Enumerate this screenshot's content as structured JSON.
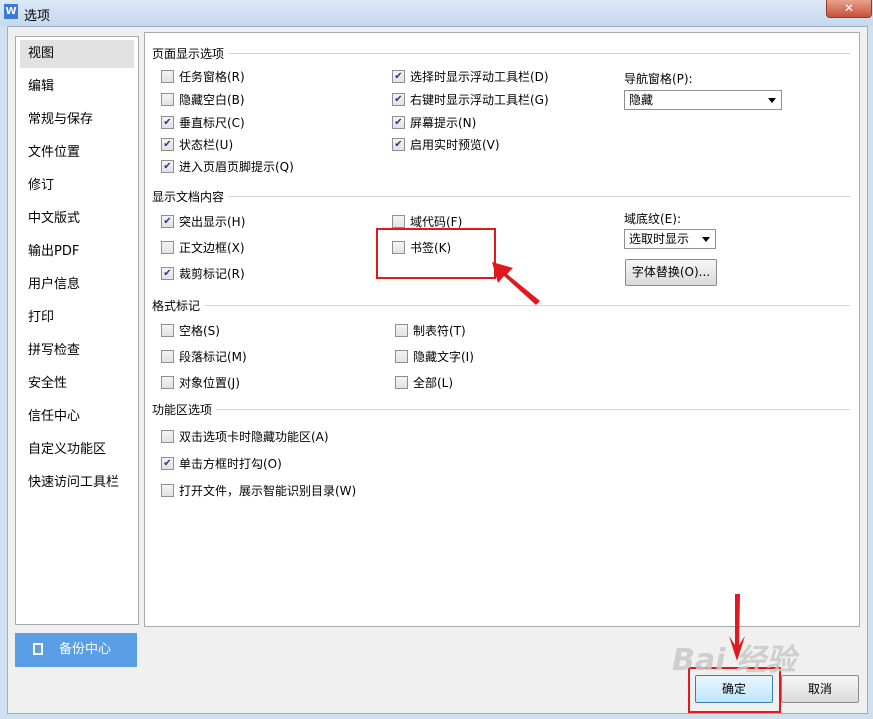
{
  "window": {
    "title": "选项",
    "app_icon_letter": "W",
    "close_glyph": "✕"
  },
  "sidebar": {
    "items": [
      {
        "label": "视图"
      },
      {
        "label": "编辑"
      },
      {
        "label": "常规与保存"
      },
      {
        "label": "文件位置"
      },
      {
        "label": "修订"
      },
      {
        "label": "中文版式"
      },
      {
        "label": "输出PDF"
      },
      {
        "label": "用户信息"
      },
      {
        "label": "打印"
      },
      {
        "label": "拼写检查"
      },
      {
        "label": "安全性"
      },
      {
        "label": "信任中心"
      },
      {
        "label": "自定义功能区"
      },
      {
        "label": "快速访问工具栏"
      }
    ],
    "active_index": 0,
    "backup_label": "备份中心"
  },
  "page_display": {
    "title": "页面显示选项",
    "col1": [
      {
        "label": "任务窗格(R)",
        "checked": false
      },
      {
        "label": "隐藏空白(B)",
        "checked": false
      },
      {
        "label": "垂直标尺(C)",
        "checked": true
      },
      {
        "label": "状态栏(U)",
        "checked": true
      },
      {
        "label": "进入页眉页脚提示(Q)",
        "checked": true
      }
    ],
    "col2": [
      {
        "label": "选择时显示浮动工具栏(D)",
        "checked": true
      },
      {
        "label": "右键时显示浮动工具栏(G)",
        "checked": true
      },
      {
        "label": "屏幕提示(N)",
        "checked": true
      },
      {
        "label": "启用实时预览(V)",
        "checked": true
      }
    ],
    "nav_label": "导航窗格(P):",
    "nav_value": "隐藏"
  },
  "doc_content": {
    "title": "显示文档内容",
    "col1": [
      {
        "label": "突出显示(H)",
        "checked": true
      },
      {
        "label": "正文边框(X)",
        "checked": false
      },
      {
        "label": "裁剪标记(R)",
        "checked": true
      }
    ],
    "col2": [
      {
        "label": "域代码(F)",
        "checked": false
      },
      {
        "label": "书签(K)",
        "checked": false
      }
    ],
    "field_label": "域底纹(E):",
    "field_value": "选取时显示",
    "font_replace_label": "字体替换(O)..."
  },
  "format_marks": {
    "title": "格式标记",
    "col1": [
      {
        "label": "空格(S)",
        "checked": false
      },
      {
        "label": "段落标记(M)",
        "checked": false
      },
      {
        "label": "对象位置(J)",
        "checked": false
      }
    ],
    "col2": [
      {
        "label": "制表符(T)",
        "checked": false
      },
      {
        "label": "隐藏文字(I)",
        "checked": false
      },
      {
        "label": "全部(L)",
        "checked": false
      }
    ]
  },
  "ribbon": {
    "title": "功能区选项",
    "items": [
      {
        "label": "双击选项卡时隐藏功能区(A)",
        "checked": false
      },
      {
        "label": "单击方框时打勾(O)",
        "checked": true
      },
      {
        "label": "打开文件，展示智能识别目录(W)",
        "checked": false
      }
    ]
  },
  "footer": {
    "ok_label": "确定",
    "cancel_label": "取消"
  },
  "watermark_text": "Bai 经验",
  "colors": {
    "highlight": "#e0191f",
    "backup_button": "#5a9ee6",
    "active_item": "#e2e2e2"
  }
}
